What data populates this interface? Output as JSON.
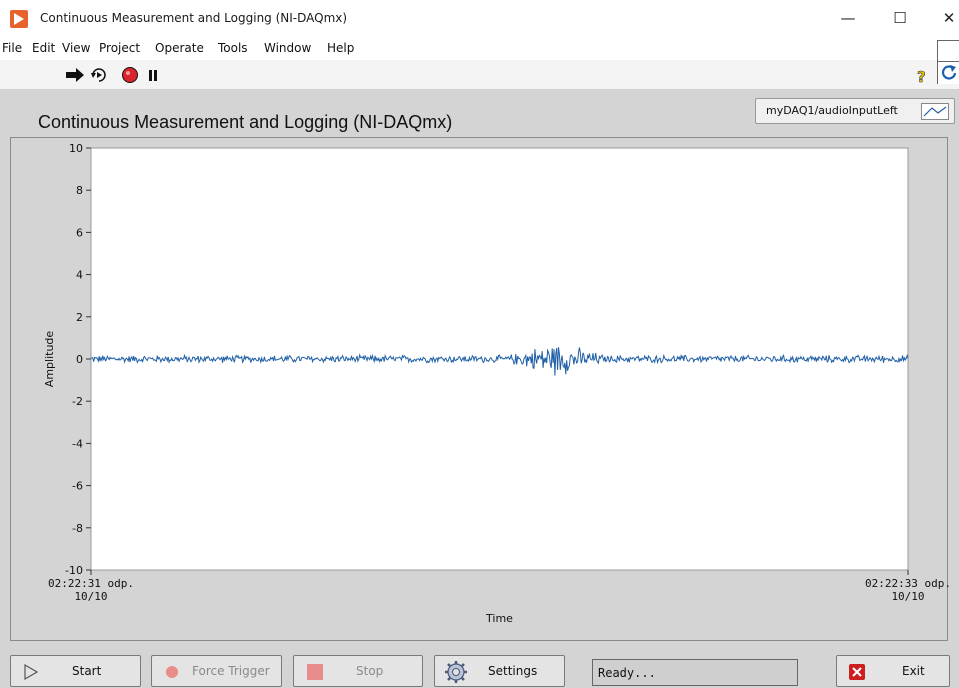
{
  "window": {
    "title": "Continuous Measurement and Logging (NI-DAQmx)",
    "min_glyph": "—",
    "max_glyph": "☐",
    "close_glyph": "✕"
  },
  "menu": [
    "File",
    "Edit",
    "View",
    "Project",
    "Operate",
    "Tools",
    "Window",
    "Help"
  ],
  "toolbar": {
    "icons": [
      "run-arrow-icon",
      "run-continuously-icon",
      "abort-icon",
      "pause-icon"
    ],
    "help_glyph": "?"
  },
  "panel": {
    "title": "Continuous Measurement and Logging (NI-DAQmx)",
    "channel": "myDAQ1/audioInputLeft"
  },
  "chart_data": {
    "type": "line",
    "xlabel": "Time",
    "ylabel": "Amplitude",
    "ylim": [
      -10,
      10
    ],
    "y_ticks": [
      "10",
      "8",
      "6",
      "4",
      "2",
      "0",
      "-2",
      "-4",
      "-6",
      "-8",
      "-10"
    ],
    "x_range": [
      "02:22:31 odp. 10/10",
      "02:22:33 odp. 10/10"
    ],
    "x_tick_labels": [
      {
        "time": "02:22:31 odp.",
        "date": "10/10"
      },
      {
        "time": "02:22:33 odp.",
        "date": "10/10"
      }
    ],
    "series": [
      {
        "color": "#1f5fa6",
        "baseline": 0,
        "typical_amplitude": 0.2,
        "peak_amplitude": 0.75,
        "peak_time": "02:22:32 odp. 10/10",
        "values": []
      }
    ],
    "grid": false,
    "plot_bg": "#ffffff"
  },
  "buttons": {
    "start": "Start",
    "force_trigger": "Force Trigger",
    "stop": "Stop",
    "settings": "Settings",
    "exit": "Exit"
  },
  "status": "Ready...",
  "colors": {
    "accent": "#e8622c",
    "panel_bg": "#d4d4d4",
    "signal": "#1f5fa6",
    "abort_red": "#d9252a",
    "exit_red": "#cc1e1e"
  }
}
